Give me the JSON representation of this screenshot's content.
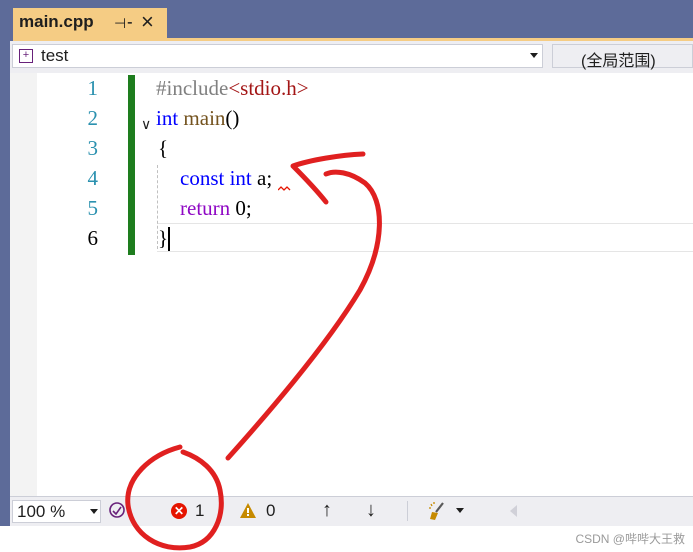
{
  "tab": {
    "title": "main.cpp",
    "pin_icon": "pin-icon",
    "close_icon": "close-icon"
  },
  "navbar": {
    "project": "test",
    "scope": "(全局范围)"
  },
  "editor": {
    "line_numbers": [
      "1",
      "2",
      "3",
      "4",
      "5",
      "6"
    ],
    "lines": [
      {
        "include": "#include",
        "header": "<stdio.h>"
      },
      {
        "type": "int",
        "func": "main",
        "parens": "()"
      },
      {
        "text": "{"
      },
      {
        "kw1": "const",
        "kw2": "int",
        "ident": "a;"
      },
      {
        "ret": "return",
        "val": "0;"
      },
      {
        "text": "}"
      }
    ],
    "current_line": "6"
  },
  "statusbar": {
    "zoom": "100 %",
    "error_count": "1",
    "warning_count": "0"
  },
  "watermark": "CSDN @哔哔大王救",
  "colors": {
    "accent_tab": "#f5cc84",
    "error": "#e51400",
    "warning": "#c68a00",
    "annotation": "#e02020"
  }
}
